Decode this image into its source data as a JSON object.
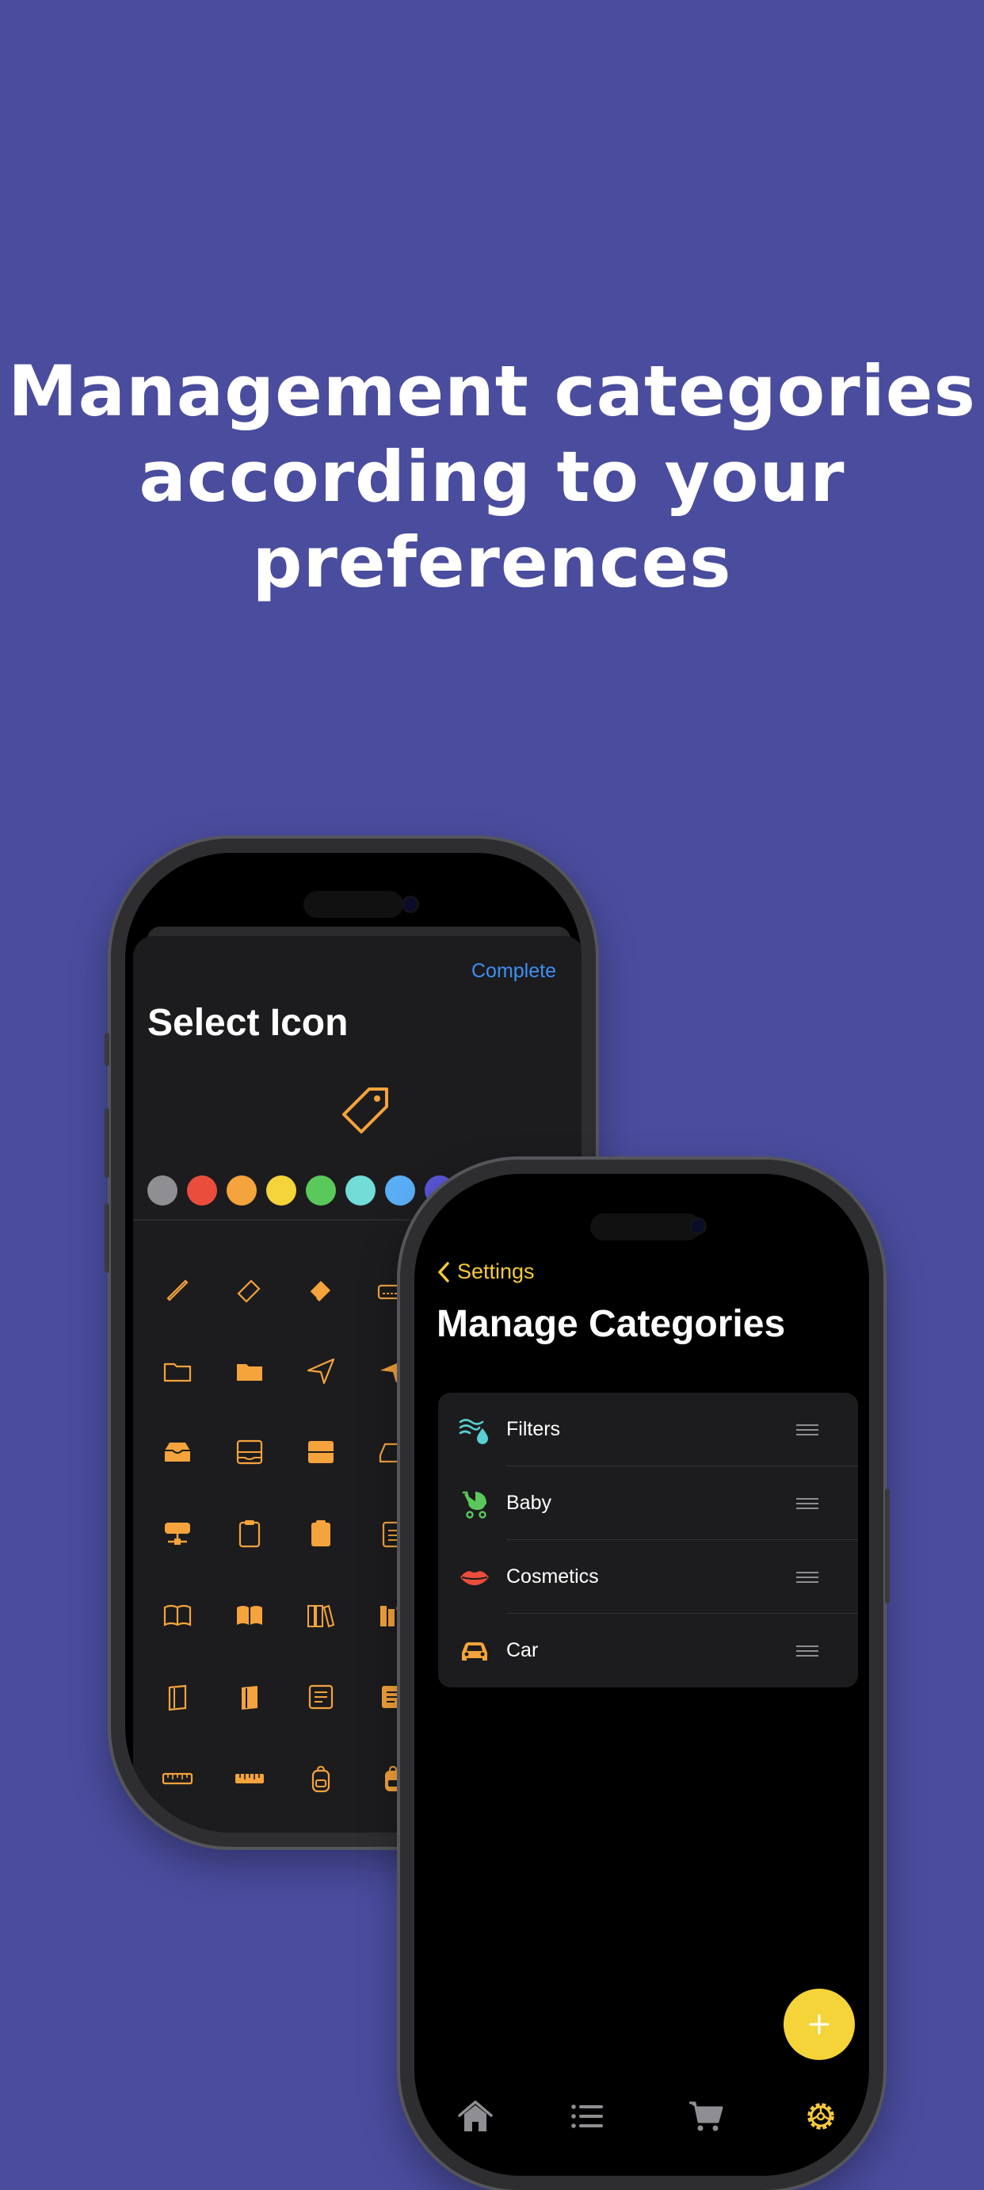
{
  "headline": {
    "line1": "Management categories",
    "line2": "according to your",
    "line3": "preferences"
  },
  "icon_picker": {
    "complete_label": "Complete",
    "title": "Select Icon",
    "selected_icon": "tag-icon",
    "accent_color": "#f5a33c",
    "colors": [
      "#8e8e93",
      "#eb4d3d",
      "#f5a33c",
      "#f5d43a",
      "#5ac85a",
      "#72dcd7",
      "#5aaef5",
      "#5856d6"
    ],
    "icons": [
      [
        "pencil-icon",
        "eraser-icon",
        "eraser-fill-icon",
        "pencil-keyboard-icon"
      ],
      [
        "folder-icon",
        "folder-fill-icon",
        "paperplane-icon",
        "paperplane-fill-icon"
      ],
      [
        "tray-fill-icon",
        "tray-2-icon",
        "tray-2-fill-icon",
        "externaldrive-icon"
      ],
      [
        "server-rack-icon",
        "clipboard-icon",
        "clipboard-fill-icon",
        "list-clipboard-icon"
      ],
      [
        "book-icon",
        "book-fill-icon",
        "books-icon",
        "books-fill-icon"
      ],
      [
        "book-closed-icon",
        "book-closed-fill-icon",
        "newspaper-icon",
        "newspaper-fill-icon"
      ],
      [
        "ruler-icon",
        "ruler-fill-icon",
        "backpack-icon",
        "backpack-fill-icon"
      ]
    ]
  },
  "categories_screen": {
    "back_label": "Settings",
    "title": "Manage Categories",
    "items": [
      {
        "label": "Filters",
        "icon": "humidity-icon",
        "color": "#5ad0d0"
      },
      {
        "label": "Baby",
        "icon": "stroller-icon",
        "color": "#5ac85a"
      },
      {
        "label": "Cosmetics",
        "icon": "lips-icon",
        "color": "#eb4d3d"
      },
      {
        "label": "Car",
        "icon": "car-icon",
        "color": "#f5a33c"
      }
    ],
    "fab_icon": "plus-icon",
    "tabs": [
      "house-icon",
      "list-icon",
      "cart-icon",
      "gear-icon"
    ],
    "active_tab": "gear-icon",
    "active_color": "#f5c93d"
  }
}
